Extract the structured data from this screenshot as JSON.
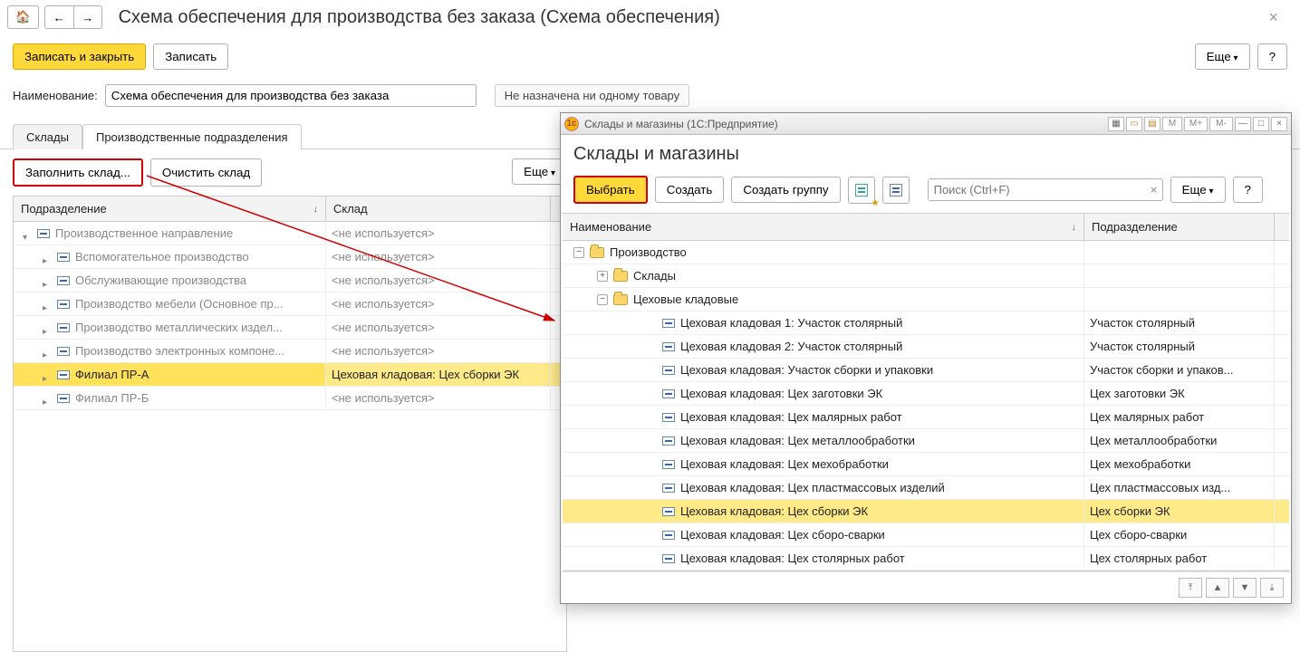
{
  "page": {
    "title": "Схема обеспечения для производства без заказа (Схема обеспечения)"
  },
  "toolbar": {
    "save_close": "Записать и закрыть",
    "save": "Записать",
    "more": "Еще",
    "help": "?"
  },
  "fields": {
    "name_label": "Наименование:",
    "name_value": "Схема обеспечения для производства без заказа",
    "assignment_note": "Не назначена ни одному товару"
  },
  "tabs": {
    "warehouses": "Склады",
    "departments": "Производственные подразделения"
  },
  "subtoolbar": {
    "fill": "Заполнить склад...",
    "clear": "Очистить склад",
    "more": "Еще"
  },
  "grid": {
    "col1": "Подразделение",
    "col2": "Склад",
    "not_used": "<не используется>",
    "rows": [
      {
        "level": 0,
        "type": "group",
        "open": true,
        "label": "Производственное направление",
        "value": "<не используется>"
      },
      {
        "level": 1,
        "type": "group",
        "open": false,
        "label": "Вспомогательное производство",
        "value": "<не используется>"
      },
      {
        "level": 1,
        "type": "group",
        "open": false,
        "label": "Обслуживающие производства",
        "value": "<не используется>"
      },
      {
        "level": 1,
        "type": "group",
        "open": false,
        "label": "Производство мебели (Основное пр...",
        "value": "<не используется>"
      },
      {
        "level": 1,
        "type": "group",
        "open": false,
        "label": "Производство металлических издел...",
        "value": "<не используется>"
      },
      {
        "level": 1,
        "type": "group",
        "open": false,
        "label": "Производство электронных компоне...",
        "value": "<не используется>"
      },
      {
        "level": 1,
        "type": "group",
        "open": false,
        "selected": true,
        "label": "Филиал ПР-А",
        "value": "Цеховая кладовая: Цех сборки ЭК"
      },
      {
        "level": 1,
        "type": "group",
        "open": false,
        "label": "Филиал ПР-Б",
        "value": "<не используется>"
      }
    ]
  },
  "dialog": {
    "window_title": "Склады и магазины  (1С:Предприятие)",
    "title": "Склады и магазины",
    "select": "Выбрать",
    "create": "Создать",
    "create_group": "Создать группу",
    "search_ph": "Поиск (Ctrl+F)",
    "more": "Еще",
    "help": "?",
    "tb": {
      "m": "M",
      "mplus": "M+",
      "mminus": "M-",
      "min": "—",
      "max": "□",
      "close": "×"
    },
    "col1": "Наименование",
    "col2": "Подразделение",
    "rows": [
      {
        "level": 0,
        "type": "folder",
        "exp": "minus",
        "label": "Производство",
        "value": ""
      },
      {
        "level": 1,
        "type": "folder",
        "exp": "plus",
        "label": "Склады",
        "value": ""
      },
      {
        "level": 1,
        "type": "folder",
        "exp": "minus",
        "label": "Цеховые кладовые",
        "value": ""
      },
      {
        "level": 2,
        "type": "item",
        "label": "Цеховая кладовая 1: Участок столярный",
        "value": "Участок столярный"
      },
      {
        "level": 2,
        "type": "item",
        "label": "Цеховая кладовая 2: Участок столярный",
        "value": "Участок столярный"
      },
      {
        "level": 2,
        "type": "item",
        "label": "Цеховая кладовая: Участок сборки и упаковки",
        "value": "Участок сборки и упаков..."
      },
      {
        "level": 2,
        "type": "item",
        "label": "Цеховая кладовая: Цех заготовки ЭК",
        "value": "Цех заготовки ЭК"
      },
      {
        "level": 2,
        "type": "item",
        "label": "Цеховая кладовая: Цех малярных работ",
        "value": "Цех малярных работ"
      },
      {
        "level": 2,
        "type": "item",
        "label": "Цеховая кладовая: Цех металлообработки",
        "value": "Цех металлообработки"
      },
      {
        "level": 2,
        "type": "item",
        "label": "Цеховая кладовая: Цех мехобработки",
        "value": "Цех мехобработки"
      },
      {
        "level": 2,
        "type": "item",
        "label": "Цеховая кладовая: Цех пластмассовых изделий",
        "value": "Цех пластмассовых изд..."
      },
      {
        "level": 2,
        "type": "item",
        "selected": true,
        "label": "Цеховая кладовая: Цех сборки ЭК",
        "value": "Цех сборки ЭК"
      },
      {
        "level": 2,
        "type": "item",
        "label": "Цеховая кладовая: Цех сборо-сварки",
        "value": "Цех сборо-сварки"
      },
      {
        "level": 2,
        "type": "item",
        "label": "Цеховая кладовая: Цех столярных работ",
        "value": "Цех столярных работ"
      }
    ]
  }
}
